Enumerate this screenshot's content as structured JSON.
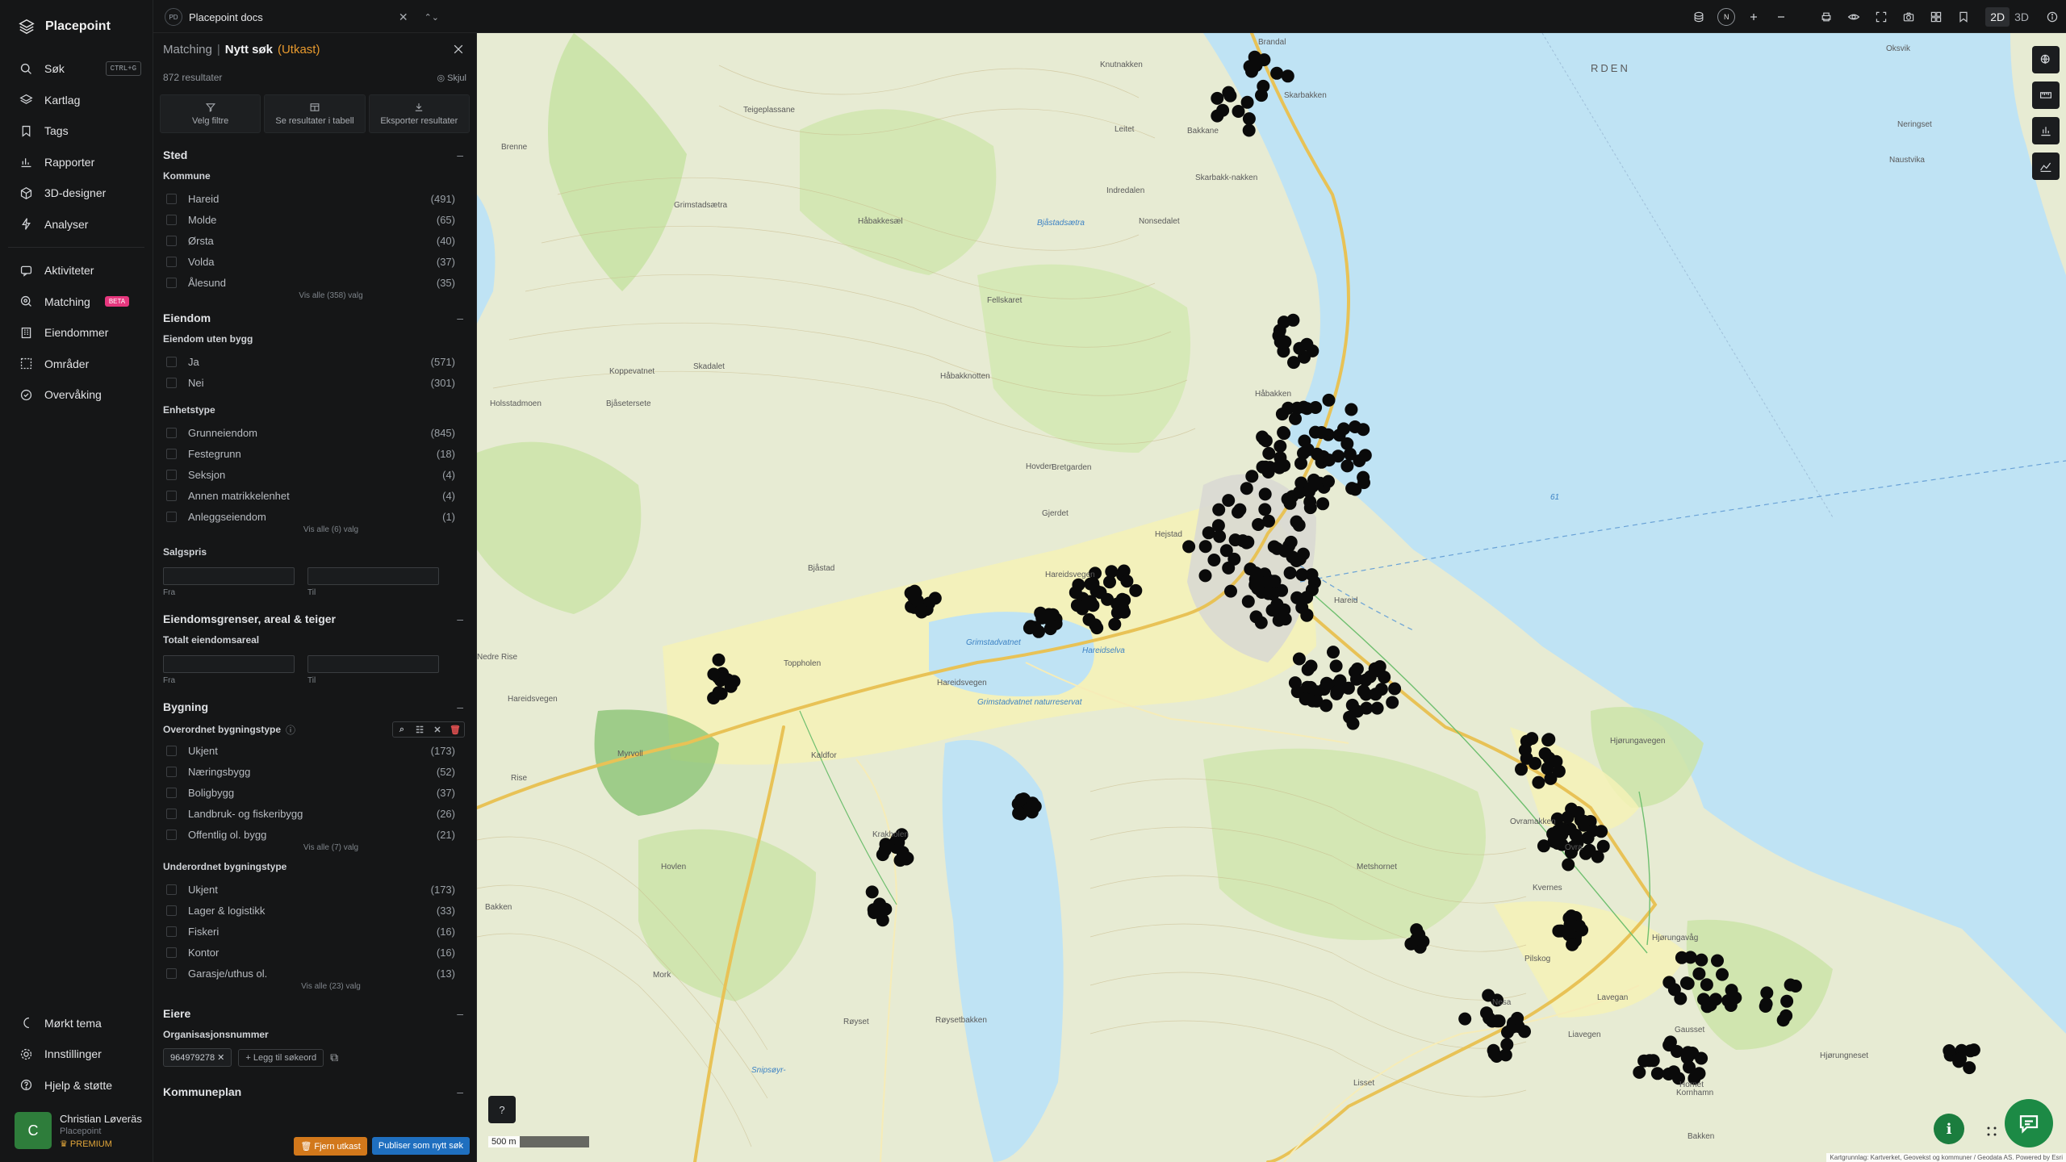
{
  "app": {
    "name": "Placepoint"
  },
  "nav": {
    "items": [
      {
        "label": "Søk",
        "shortcut": "CTRL+G"
      },
      {
        "label": "Kartlag"
      },
      {
        "label": "Tags"
      },
      {
        "label": "Rapporter"
      },
      {
        "label": "3D-designer"
      },
      {
        "label": "Analyser"
      }
    ],
    "items2": [
      {
        "label": "Aktiviteter"
      },
      {
        "label": "Matching",
        "badge": "BETA"
      },
      {
        "label": "Eiendommer"
      },
      {
        "label": "Områder"
      },
      {
        "label": "Overvåking"
      }
    ],
    "bottom": [
      {
        "label": "Mørkt tema"
      },
      {
        "label": "Innstillinger"
      },
      {
        "label": "Hjelp & støtte"
      }
    ],
    "user": {
      "initial": "C",
      "name": "Christian Løveräs",
      "org": "Placepoint",
      "plan": "PREMIUM"
    }
  },
  "topbar": {
    "project_initials": "PD",
    "project_name": "Placepoint docs",
    "compass": "N",
    "view_2d": "2D",
    "view_3d": "3D"
  },
  "panel": {
    "crumb_parent": "Matching",
    "crumb_sep": "|",
    "title": "Nytt søk",
    "status": "(Utkast)",
    "results": "872 resultater",
    "hide": "Skjul",
    "actions": [
      "Velg filtre",
      "Se resultater i tabell",
      "Eksporter resultater"
    ],
    "sections": {
      "sted": {
        "title": "Sted",
        "sub": "Kommune",
        "rows": [
          {
            "label": "Hareid",
            "count": "(491)"
          },
          {
            "label": "Molde",
            "count": "(65)"
          },
          {
            "label": "Ørsta",
            "count": "(40)"
          },
          {
            "label": "Volda",
            "count": "(37)"
          },
          {
            "label": "Ålesund",
            "count": "(35)"
          }
        ],
        "more": "Vis alle (358) valg"
      },
      "eiendom": {
        "title": "Eiendom",
        "sub1": "Eiendom uten bygg",
        "rows1": [
          {
            "label": "Ja",
            "count": "(571)"
          },
          {
            "label": "Nei",
            "count": "(301)"
          }
        ],
        "sub2": "Enhetstype",
        "rows2": [
          {
            "label": "Grunneiendom",
            "count": "(845)"
          },
          {
            "label": "Festegrunn",
            "count": "(18)"
          },
          {
            "label": "Seksjon",
            "count": "(4)"
          },
          {
            "label": "Annen matrikkelenhet",
            "count": "(4)"
          },
          {
            "label": "Anleggseiendom",
            "count": "(1)"
          }
        ],
        "more": "Vis alle (6) valg",
        "sub3": "Salgspris",
        "from": "Fra",
        "to": "Til"
      },
      "grenser": {
        "title": "Eiendomsgrenser, areal & teiger",
        "sub": "Totalt eiendomsareal",
        "from": "Fra",
        "to": "Til"
      },
      "bygning": {
        "title": "Bygning",
        "sub1": "Overordnet bygningstype",
        "rows1": [
          {
            "label": "Ukjent",
            "count": "(173)"
          },
          {
            "label": "Næringsbygg",
            "count": "(52)"
          },
          {
            "label": "Boligbygg",
            "count": "(37)"
          },
          {
            "label": "Landbruk- og fiskeribygg",
            "count": "(26)"
          },
          {
            "label": "Offentlig ol. bygg",
            "count": "(21)"
          }
        ],
        "more1": "Vis alle (7) valg",
        "sub2": "Underordnet bygningstype",
        "rows2": [
          {
            "label": "Ukjent",
            "count": "(173)"
          },
          {
            "label": "Lager & logistikk",
            "count": "(33)"
          },
          {
            "label": "Fiskeri",
            "count": "(16)"
          },
          {
            "label": "Kontor",
            "count": "(16)"
          },
          {
            "label": "Garasje/uthus ol.",
            "count": "(13)"
          }
        ],
        "more2": "Vis alle (23) valg"
      },
      "eiere": {
        "title": "Eiere",
        "sub": "Organisasjonsnummer",
        "chip": "964979278",
        "add": "Legg til søkeord"
      },
      "kommuneplan": {
        "title": "Kommuneplan"
      }
    },
    "remove_draft": "Fjern utkast",
    "publish": "Publiser som nytt søk"
  },
  "map": {
    "scale": "500 m",
    "help": "?",
    "attribution": "Kartgrunnlag: Kartverket, Geovekst og kommuner / Geodata AS. Powered by Esri",
    "labels": [
      {
        "text": "Brandal"
      },
      {
        "text": "Knutnakken"
      },
      {
        "text": "Skarbakken"
      },
      {
        "text": "Leitet"
      },
      {
        "text": "Bakkane"
      },
      {
        "text": "Teigeplassane"
      },
      {
        "text": "Brenne"
      },
      {
        "text": "Skarbakk-nakken"
      },
      {
        "text": "Indredalen"
      },
      {
        "text": "Nonsedalet"
      },
      {
        "text": "Grimstadsætra"
      },
      {
        "text": "Håbakkesæl"
      },
      {
        "text": "Fellskaret"
      },
      {
        "text": "Bjåstadsætra"
      },
      {
        "text": "Koppevatnet"
      },
      {
        "text": "Skadalet"
      },
      {
        "text": "Bjåsetersete"
      },
      {
        "text": "Holsstadmoen"
      },
      {
        "text": "Håbakknotten"
      },
      {
        "text": "Håbakken"
      },
      {
        "text": "Hovden"
      },
      {
        "text": "Gjerdet"
      },
      {
        "text": "Bretgarden"
      },
      {
        "text": "Hejstad"
      },
      {
        "text": "Bjåstad"
      },
      {
        "text": "Hareidsvegen"
      },
      {
        "text": "Hareid"
      },
      {
        "text": "Grimstadvatnet"
      },
      {
        "text": "Hareidselva"
      },
      {
        "text": "Nedre Rise"
      },
      {
        "text": "Rise"
      },
      {
        "text": "Toppholen"
      },
      {
        "text": "Kaldfor"
      },
      {
        "text": "Myrvoll"
      },
      {
        "text": "Hareidsvegen"
      },
      {
        "text": "Krakholen"
      },
      {
        "text": "Hovlen"
      },
      {
        "text": "Bakken"
      },
      {
        "text": "Mork"
      },
      {
        "text": "Røyset"
      },
      {
        "text": "Røysetbakken"
      },
      {
        "text": "Snipsøyr-"
      },
      {
        "text": "Metshornet"
      },
      {
        "text": "Ovra"
      },
      {
        "text": "Kvernes"
      },
      {
        "text": "Hjørungavåg"
      },
      {
        "text": "Pilskog"
      },
      {
        "text": "Lisset"
      },
      {
        "text": "Liavegen"
      },
      {
        "text": "Nesa"
      },
      {
        "text": "Gausset"
      },
      {
        "text": "Hjørungneset"
      },
      {
        "text": "Hornet"
      },
      {
        "text": "Kornhamn"
      },
      {
        "text": "Bakken"
      },
      {
        "text": "Oksvik"
      },
      {
        "text": "Neringset"
      },
      {
        "text": "Naustvika"
      },
      {
        "text": "Hjørungavegen"
      },
      {
        "text": "Ovramakken"
      },
      {
        "text": "Lavegan"
      },
      {
        "text": "Hareidsvegen"
      },
      {
        "text": "Grimstadvatnet naturreservat"
      },
      {
        "text": "RDEN"
      },
      {
        "text": "61"
      }
    ]
  }
}
